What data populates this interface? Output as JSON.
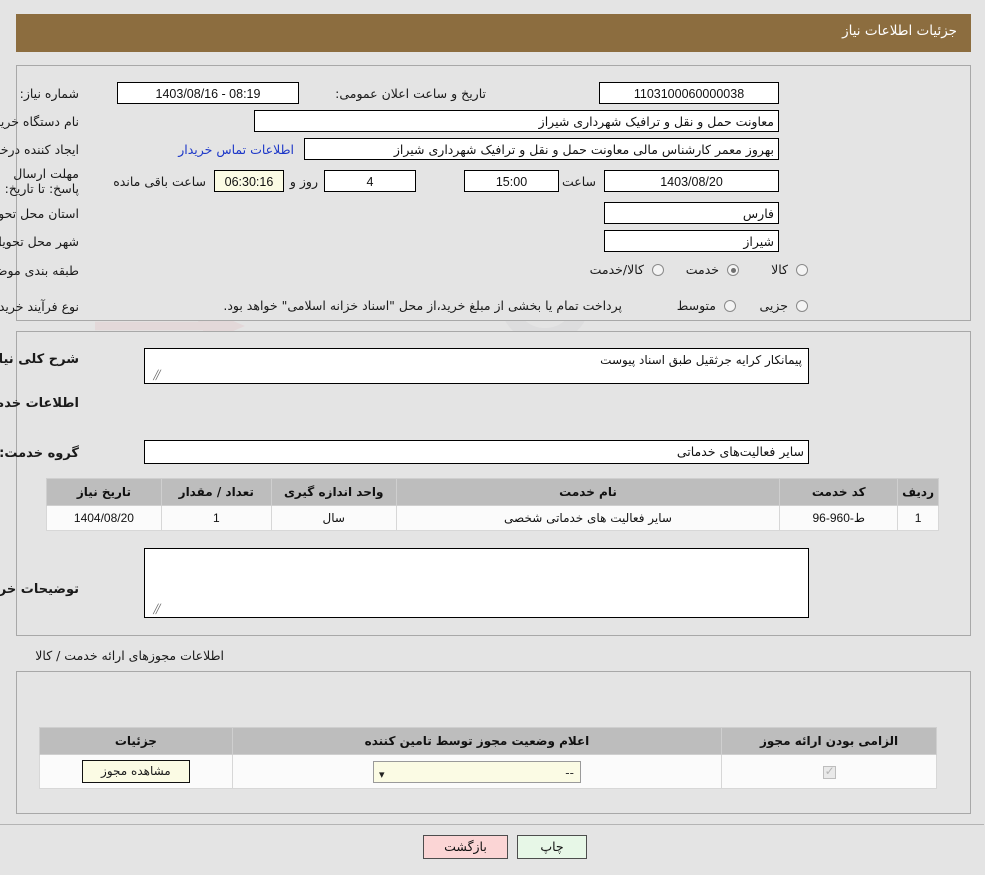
{
  "header": {
    "title": "جزئیات اطلاعات نیاز"
  },
  "watermark": {
    "text": "AriaTender.net"
  },
  "top_panel": {
    "need_number_label": "شماره نیاز:",
    "need_number_value": "1103100060000038",
    "public_announce_label": "تاریخ و ساعت اعلان عمومی:",
    "public_announce_value": "1403/08/16 - 08:19",
    "buyer_org_label": "نام دستگاه خریدار:",
    "buyer_org_value": "معاونت حمل و نقل و ترافیک شهرداری شیراز",
    "requester_label": "ایجاد کننده درخواست:",
    "requester_value": "بهروز معمر کارشناس مالی معاونت حمل و نقل و ترافیک شهرداری شیراز",
    "contact_link": "اطلاعات تماس خریدار",
    "deadline_label": "مهلت ارسال پاسخ: تا تاریخ:",
    "deadline_date": "1403/08/20",
    "hour_label": "ساعت",
    "deadline_time": "15:00",
    "days_remaining": "4",
    "days_label": "روز و",
    "time_remaining": "06:30:16",
    "remaining_label": "ساعت باقی مانده",
    "province_label": "استان محل تحویل:",
    "province_value": "فارس",
    "city_label": "شهر محل تحویل:",
    "city_value": "شیراز",
    "category_label": "طبقه بندی موضوعی:",
    "category_options": [
      {
        "label": "کالا",
        "selected": false
      },
      {
        "label": "خدمت",
        "selected": true
      },
      {
        "label": "کالا/خدمت",
        "selected": false
      }
    ],
    "process_label": "نوع فرآیند خرید :",
    "process_options": [
      {
        "label": "جزیی",
        "selected": false
      },
      {
        "label": "متوسط",
        "selected": false
      }
    ],
    "payment_note": "پرداخت تمام یا بخشی از مبلغ خرید،از محل \"اسناد خزانه اسلامی\" خواهد بود."
  },
  "mid_panel": {
    "general_desc_label": "شرح کلی نیاز:",
    "general_desc_value": "پیمانکار کرایه جرثقیل طبق اسناد پیوست",
    "services_info_title": "اطلاعات خدمات مورد نیاز",
    "service_group_label": "گروه خدمت:",
    "service_group_value": "سایر فعالیت‌های خدماتی",
    "services_table": {
      "columns": [
        "ردیف",
        "کد خدمت",
        "نام خدمت",
        "واحد اندازه گیری",
        "تعداد / مقدار",
        "تاریخ نیاز"
      ],
      "rows": [
        {
          "row": "1",
          "code": "ط-960-96",
          "name": "سایر فعالیت های خدماتی شخصی",
          "unit": "سال",
          "quantity": "1",
          "need_date": "1404/08/20"
        }
      ]
    },
    "buyer_notes_label": "توضیحات خریدار:",
    "buyer_notes_value": ""
  },
  "permits_section": {
    "title": "اطلاعات مجوزهای ارائه خدمت / کالا",
    "table": {
      "columns": [
        "الزامی بودن ارائه مجوز",
        "اعلام وضعیت مجوز توسط تامین کننده",
        "جزئیات"
      ],
      "rows": [
        {
          "required": true,
          "status_value": "--",
          "details_button": "مشاهده مجوز"
        }
      ]
    }
  },
  "footer": {
    "back_label": "بازگشت",
    "print_label": "چاپ"
  }
}
